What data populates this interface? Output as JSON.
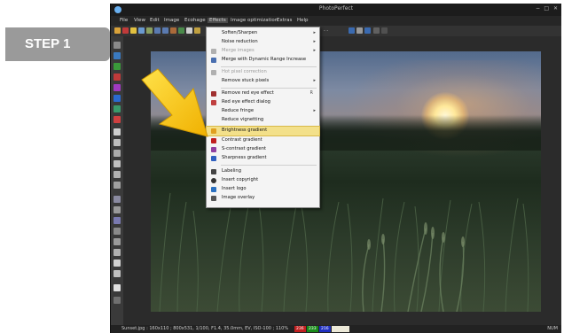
{
  "step_label": "STEP 1",
  "window": {
    "title": "PhotoPerfect",
    "controls": {
      "minimize": "−",
      "maximize": "□",
      "close": "✕"
    }
  },
  "menubar": {
    "items": [
      "File",
      "View",
      "Edit",
      "Image",
      "Ecohage",
      "Effects",
      "Image optimization",
      "Extras",
      "Help"
    ]
  },
  "toolbar": {
    "zoom_text": "- -"
  },
  "effects_menu": {
    "items": [
      {
        "label": "Soften/Sharpen",
        "arrow": "▸",
        "enabled": true,
        "icon": "blank",
        "color": ""
      },
      {
        "label": "Noise reduction",
        "arrow": "▸",
        "enabled": true,
        "icon": "blank",
        "color": ""
      },
      {
        "label": "Merge images",
        "arrow": "▸",
        "enabled": false,
        "icon": "merge-icon",
        "color": "#b0b0b0"
      },
      {
        "label": "Merge with Dynamic Range Increase",
        "arrow": "",
        "enabled": true,
        "icon": "hdr-merge-icon",
        "color": "#4a6fb0"
      },
      {
        "label": "Hot pixel correction",
        "arrow": "",
        "enabled": false,
        "icon": "hot-pixel-icon",
        "color": "#b0b0b0"
      },
      {
        "label": "Remove stuck pixels",
        "arrow": "▸",
        "enabled": true,
        "icon": "blank",
        "color": ""
      },
      {
        "label": "Remove red eye effect",
        "arrow": "",
        "key": "R",
        "enabled": true,
        "icon": "red-eye-icon",
        "color": "#a03030"
      },
      {
        "label": "Red eye effect dialog",
        "arrow": "",
        "enabled": true,
        "icon": "red-eye-dialog-icon",
        "color": "#c04040"
      },
      {
        "label": "Reduce fringe",
        "arrow": "▸",
        "enabled": true,
        "icon": "blank",
        "color": ""
      },
      {
        "label": "Reduce vignetting",
        "arrow": "",
        "enabled": true,
        "icon": "blank",
        "color": ""
      },
      {
        "label": "Brightness gradient",
        "arrow": "",
        "enabled": true,
        "icon": "brightness-gradient-icon",
        "color": "#e0a020"
      },
      {
        "label": "Contrast gradient",
        "arrow": "",
        "enabled": true,
        "icon": "contrast-gradient-icon",
        "color": "#c02020"
      },
      {
        "label": "S-contrast gradient",
        "arrow": "",
        "enabled": true,
        "icon": "s-contrast-gradient-icon",
        "color": "#9040a0"
      },
      {
        "label": "Sharpness gradient",
        "arrow": "",
        "enabled": true,
        "icon": "sharpness-gradient-icon",
        "color": "#3060c0"
      },
      {
        "label": "Labeling",
        "arrow": "",
        "enabled": true,
        "icon": "labeling-icon",
        "color": "#444444"
      },
      {
        "label": "Insert copyright",
        "arrow": "",
        "enabled": true,
        "icon": "copyright-icon",
        "color": "#333333"
      },
      {
        "label": "Insert logo",
        "arrow": "",
        "enabled": true,
        "icon": "logo-icon",
        "color": "#2a70c0"
      },
      {
        "label": "Image overlay",
        "arrow": "",
        "enabled": true,
        "icon": "overlay-icon",
        "color": "#555555"
      }
    ]
  },
  "statusbar": {
    "text": "Sunset.jpg : 160x110 ; 800x531, 1/100, F1.4, 35.0mm, EV, ISO-100 ; 110%",
    "r": "236",
    "g": "233",
    "b": "216",
    "mode": "NUM"
  },
  "colors": {
    "highlight": "#f3e08a",
    "arrow": "#f5c400",
    "step_bg": "#9a9a9a"
  }
}
